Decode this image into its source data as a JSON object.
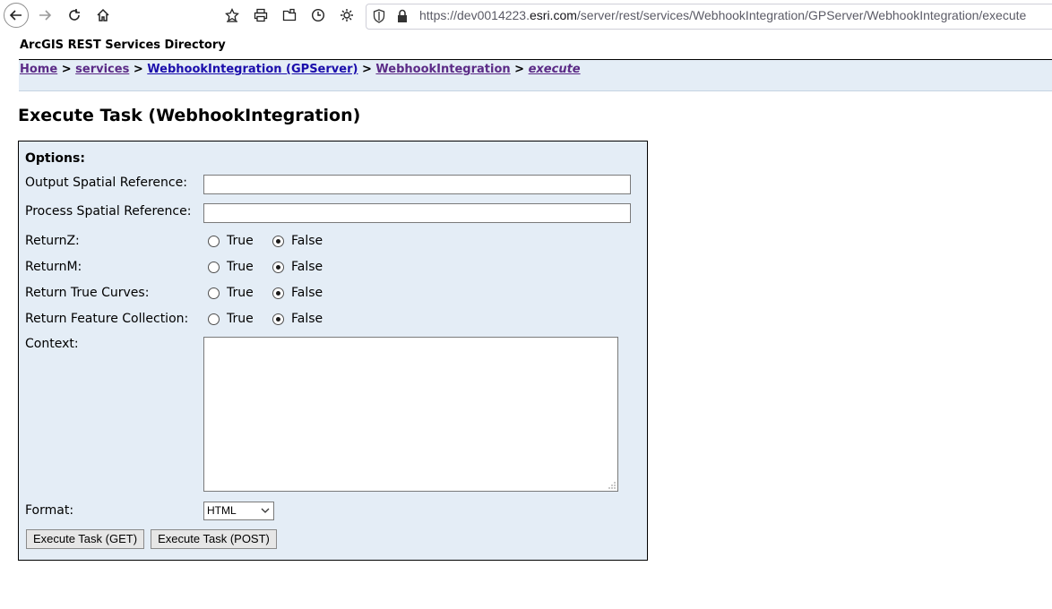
{
  "browser": {
    "url_prefix": "https://dev0014223.",
    "url_host": "esri.com",
    "url_path": "/server/rest/services/WebhookIntegration/GPServer/WebhookIntegration/execute",
    "icons": [
      "back-icon",
      "forward-icon",
      "reload-icon",
      "home-icon",
      "bookmark-star-icon",
      "print-icon",
      "share-icon",
      "history-icon",
      "settings-gear-icon",
      "shield-icon",
      "lock-icon"
    ]
  },
  "header": {
    "directory_title": "ArcGIS REST Services Directory"
  },
  "breadcrumb": {
    "home": "Home",
    "services": "services",
    "gpserver": "WebhookIntegration (GPServer)",
    "task": "WebhookIntegration",
    "execute": "execute",
    "separator": ">"
  },
  "page_title": "Execute Task (WebhookIntegration)",
  "form": {
    "options_heading": "Options:",
    "output_sr_label": "Output Spatial Reference:",
    "output_sr_value": "",
    "process_sr_label": "Process Spatial Reference:",
    "process_sr_value": "",
    "true_label": "True",
    "false_label": "False",
    "returnz_label": "ReturnZ:",
    "returnm_label": "ReturnM:",
    "curves_label": "Return True Curves:",
    "feature_collection_label": "Return Feature Collection:",
    "context_label": "Context:",
    "context_value": "",
    "format_label": "Format:",
    "format_value": "HTML",
    "get_button": "Execute Task (GET)",
    "post_button": "Execute Task (POST)"
  }
}
